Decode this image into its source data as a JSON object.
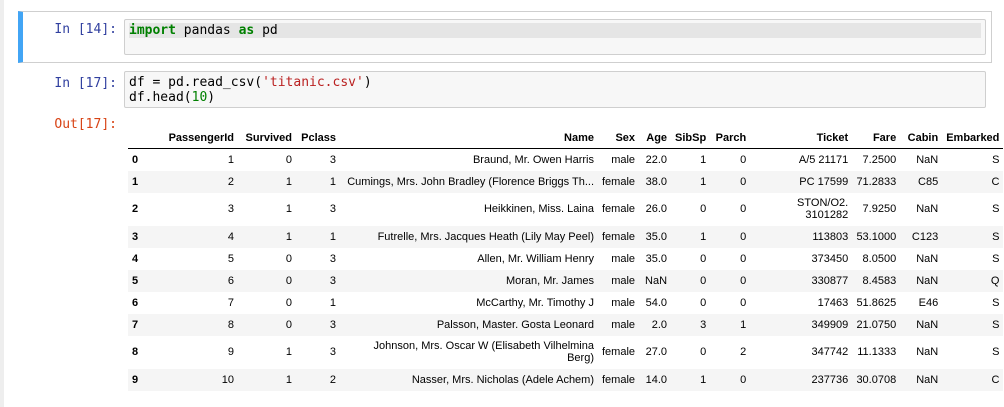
{
  "cells": [
    {
      "prompt": "In [14]:",
      "code": {
        "kw1": "import",
        "mod": " pandas ",
        "kw2": "as",
        "alias": " pd"
      }
    },
    {
      "prompt": "In [17]:",
      "line1": {
        "a": "df = pd.read_csv(",
        "s": "'titanic.csv'",
        "b": ")"
      },
      "line2": {
        "a": "df.head(",
        "n": "10",
        "b": ")"
      }
    }
  ],
  "output": {
    "prompt": "Out[17]:",
    "columns": [
      "PassengerId",
      "Survived",
      "Pclass",
      "Name",
      "Sex",
      "Age",
      "SibSp",
      "Parch",
      "Ticket",
      "Fare",
      "Cabin",
      "Embarked"
    ],
    "rows": [
      {
        "idx": "0",
        "PassengerId": "1",
        "Survived": "0",
        "Pclass": "3",
        "Name": "Braund, Mr. Owen Harris",
        "Sex": "male",
        "Age": "22.0",
        "SibSp": "1",
        "Parch": "0",
        "Ticket": "A/5 21171",
        "Fare": "7.2500",
        "Cabin": "NaN",
        "Embarked": "S"
      },
      {
        "idx": "1",
        "PassengerId": "2",
        "Survived": "1",
        "Pclass": "1",
        "Name": "Cumings, Mrs. John Bradley (Florence Briggs Th...",
        "Sex": "female",
        "Age": "38.0",
        "SibSp": "1",
        "Parch": "0",
        "Ticket": "PC 17599",
        "Fare": "71.2833",
        "Cabin": "C85",
        "Embarked": "C"
      },
      {
        "idx": "2",
        "PassengerId": "3",
        "Survived": "1",
        "Pclass": "3",
        "Name": "Heikkinen, Miss. Laina",
        "Sex": "female",
        "Age": "26.0",
        "SibSp": "0",
        "Parch": "0",
        "Ticket": "STON/O2. 3101282",
        "Fare": "7.9250",
        "Cabin": "NaN",
        "Embarked": "S"
      },
      {
        "idx": "3",
        "PassengerId": "4",
        "Survived": "1",
        "Pclass": "1",
        "Name": "Futrelle, Mrs. Jacques Heath (Lily May Peel)",
        "Sex": "female",
        "Age": "35.0",
        "SibSp": "1",
        "Parch": "0",
        "Ticket": "113803",
        "Fare": "53.1000",
        "Cabin": "C123",
        "Embarked": "S"
      },
      {
        "idx": "4",
        "PassengerId": "5",
        "Survived": "0",
        "Pclass": "3",
        "Name": "Allen, Mr. William Henry",
        "Sex": "male",
        "Age": "35.0",
        "SibSp": "0",
        "Parch": "0",
        "Ticket": "373450",
        "Fare": "8.0500",
        "Cabin": "NaN",
        "Embarked": "S"
      },
      {
        "idx": "5",
        "PassengerId": "6",
        "Survived": "0",
        "Pclass": "3",
        "Name": "Moran, Mr. James",
        "Sex": "male",
        "Age": "NaN",
        "SibSp": "0",
        "Parch": "0",
        "Ticket": "330877",
        "Fare": "8.4583",
        "Cabin": "NaN",
        "Embarked": "Q"
      },
      {
        "idx": "6",
        "PassengerId": "7",
        "Survived": "0",
        "Pclass": "1",
        "Name": "McCarthy, Mr. Timothy J",
        "Sex": "male",
        "Age": "54.0",
        "SibSp": "0",
        "Parch": "0",
        "Ticket": "17463",
        "Fare": "51.8625",
        "Cabin": "E46",
        "Embarked": "S"
      },
      {
        "idx": "7",
        "PassengerId": "8",
        "Survived": "0",
        "Pclass": "3",
        "Name": "Palsson, Master. Gosta Leonard",
        "Sex": "male",
        "Age": "2.0",
        "SibSp": "3",
        "Parch": "1",
        "Ticket": "349909",
        "Fare": "21.0750",
        "Cabin": "NaN",
        "Embarked": "S"
      },
      {
        "idx": "8",
        "PassengerId": "9",
        "Survived": "1",
        "Pclass": "3",
        "Name": "Johnson, Mrs. Oscar W (Elisabeth Vilhelmina Berg)",
        "Sex": "female",
        "Age": "27.0",
        "SibSp": "0",
        "Parch": "2",
        "Ticket": "347742",
        "Fare": "11.1333",
        "Cabin": "NaN",
        "Embarked": "S"
      },
      {
        "idx": "9",
        "PassengerId": "10",
        "Survived": "1",
        "Pclass": "2",
        "Name": "Nasser, Mrs. Nicholas (Adele Achem)",
        "Sex": "female",
        "Age": "14.0",
        "SibSp": "1",
        "Parch": "0",
        "Ticket": "237736",
        "Fare": "30.0708",
        "Cabin": "NaN",
        "Embarked": "C"
      }
    ]
  },
  "colors": {
    "selected_border": "#42a5f5",
    "prompt_in": "#303f9f",
    "prompt_out": "#d84315",
    "keyword": "#008000",
    "string": "#ba2121"
  }
}
